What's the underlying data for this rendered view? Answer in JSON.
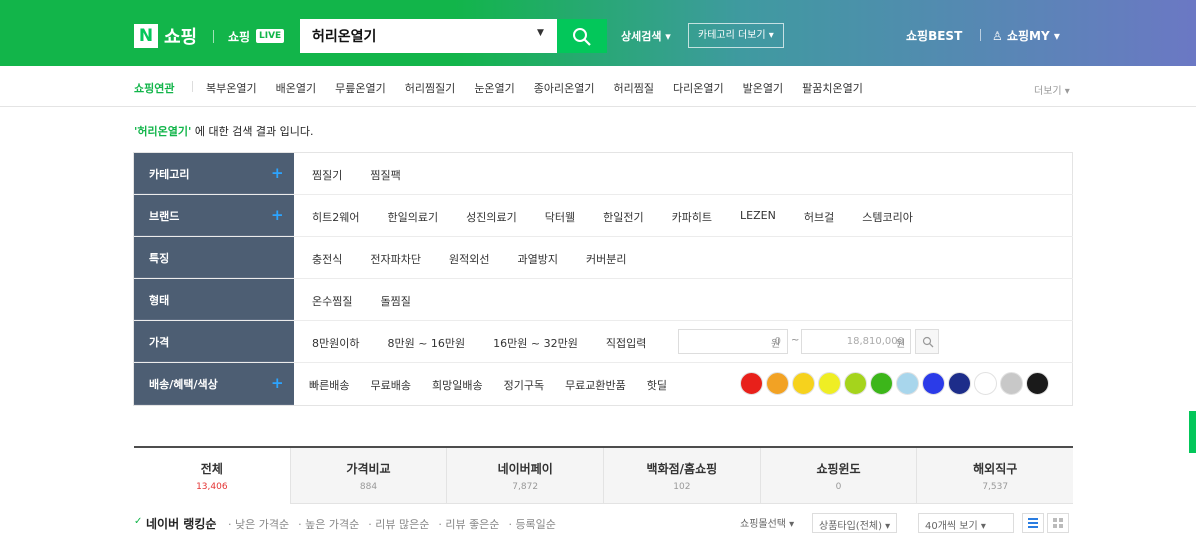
{
  "header": {
    "logo_n": "N",
    "logo_text": "쇼핑",
    "live_text": "쇼핑",
    "live_badge": "LIVE",
    "search_value": "허리온열기",
    "advanced_search": "상세검색 ▾",
    "category_more": "카테고리 더보기 ▾",
    "best": "쇼핑BEST",
    "my": "쇼핑MY ▾",
    "colors": {
      "green": "#03c75a",
      "gradient_end": "#6b78c4"
    }
  },
  "related": {
    "label": "쇼핑연관",
    "items": [
      "복부온열기",
      "배온열기",
      "무릎온열기",
      "허리찜질기",
      "눈온열기",
      "종아리온열기",
      "허리찜질",
      "다리온열기",
      "발온열기",
      "팔꿈치온열기"
    ],
    "more": "더보기 ▾"
  },
  "result": {
    "query": "'허리온열기'",
    "suffix": " 에 대한 검색 결과 입니다."
  },
  "filters": {
    "category": {
      "head": "카테고리",
      "options": [
        "찜질기",
        "찜질팩"
      ]
    },
    "brand": {
      "head": "브랜드",
      "options": [
        "히트2웨어",
        "한일의료기",
        "성진의료기",
        "닥터웰",
        "한일전기",
        "카파히트",
        "LEZEN",
        "허브걸",
        "스템코리아"
      ]
    },
    "feature": {
      "head": "특징",
      "options": [
        "충전식",
        "전자파차단",
        "원적외선",
        "과열방지",
        "커버분리"
      ]
    },
    "form": {
      "head": "형태",
      "options": [
        "온수찜질",
        "돌찜질"
      ]
    },
    "price": {
      "head": "가격",
      "options": [
        "8만원이하",
        "8만원 ~ 16만원",
        "16만원 ~ 32만원",
        "직접입력"
      ],
      "min_placeholder": "0",
      "max_placeholder": "18,810,000",
      "unit": "원",
      "tilde": "~"
    },
    "delivery": {
      "head": "배송/혜택/색상",
      "options": [
        "빠른배송",
        "무료배송",
        "희망일배송",
        "정기구독",
        "무료교환반품",
        "핫딜"
      ],
      "colors": [
        "#e8201a",
        "#f2a224",
        "#f6d21d",
        "#efee24",
        "#a5d41c",
        "#3cb61a",
        "#a8d6ec",
        "#2b3be8",
        "#1d2d8a",
        "#ffffff",
        "#c8c8c8",
        "#1a1a1a"
      ]
    },
    "plus": "+"
  },
  "tabs": [
    {
      "label": "전체",
      "count": "13,406"
    },
    {
      "label": "가격비교",
      "count": "884"
    },
    {
      "label": "네이버페이",
      "count": "7,872"
    },
    {
      "label": "백화점/홈쇼핑",
      "count": "102"
    },
    {
      "label": "쇼핑윈도",
      "count": "0"
    },
    {
      "label": "해외직구",
      "count": "7,537"
    }
  ],
  "sort": {
    "check": "✓",
    "active": "네이버 랭킹순",
    "items": [
      "낮은 가격순",
      "높은 가격순",
      "리뷰 많은순",
      "리뷰 좋은순",
      "등록일순"
    ],
    "mall_select": "쇼핑몰선택 ▾",
    "type_select": "상품타입(전체) ▾",
    "view_count": "40개씩 보기 ▾"
  }
}
